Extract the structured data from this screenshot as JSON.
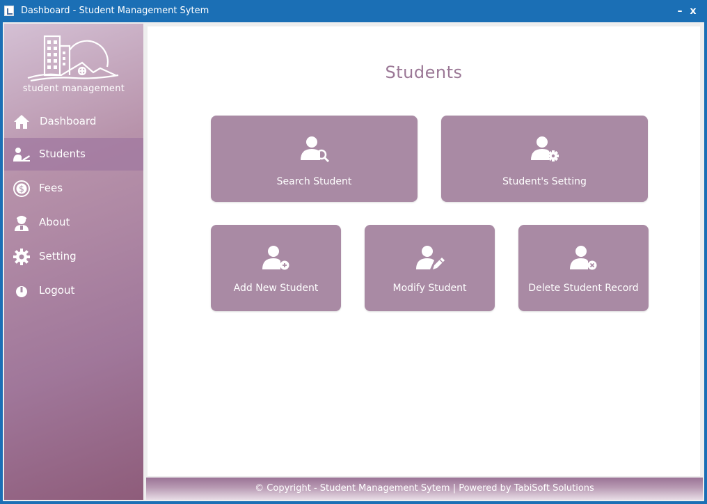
{
  "window": {
    "title": "Dashboard - Student Management Sytem",
    "minimize_label": "–",
    "close_label": "x"
  },
  "sidebar": {
    "brand": "student management",
    "items": [
      {
        "label": "Dashboard",
        "icon": "home-icon"
      },
      {
        "label": "Students",
        "icon": "student-icon",
        "active": true
      },
      {
        "label": "Fees",
        "icon": "dollar-coin-icon"
      },
      {
        "label": "About",
        "icon": "person-info-icon"
      },
      {
        "label": "Setting",
        "icon": "gear-icon"
      },
      {
        "label": "Logout",
        "icon": "power-icon"
      }
    ]
  },
  "main": {
    "title": "Students",
    "tiles": [
      {
        "label": "Search Student",
        "icon": "user-search-icon"
      },
      {
        "label": "Student's Setting",
        "icon": "user-settings-icon"
      },
      {
        "label": "Add New Student",
        "icon": "user-add-icon"
      },
      {
        "label": "Modify Student",
        "icon": "user-edit-icon"
      },
      {
        "label": "Delete Student Record",
        "icon": "user-delete-icon"
      }
    ]
  },
  "footer": {
    "text": "© Copyright - Student Management Sytem | Powered by TabiSoft Solutions"
  },
  "colors": {
    "titlebar": "#1b6fb5",
    "tile": "#a98aa4",
    "title_text": "#9b7896",
    "active_item": "#a078a0"
  }
}
